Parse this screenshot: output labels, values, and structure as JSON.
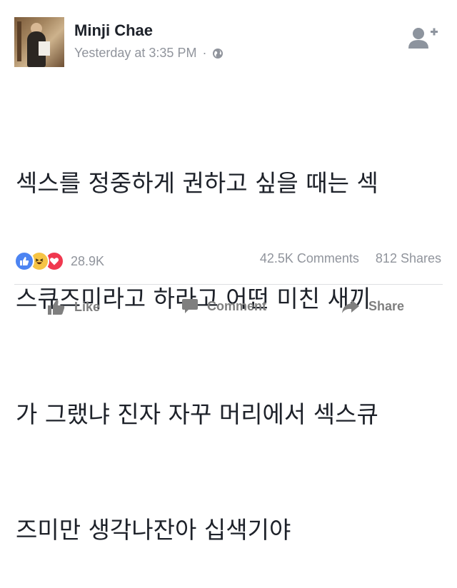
{
  "post": {
    "author": "Minji Chae",
    "timestamp": "Yesterday at 3:35 PM",
    "separator": "·",
    "privacy_icon": "globe-icon",
    "text_lines": [
      "섹스를 정중하게 권하고 싶을 때는 섹",
      "스큐즈미라고 하라고 어떤 미친 새끼",
      "가 그랬냐 진자 자꾸 머리에서 섹스큐",
      "즈미만 생각나잔아 십색기야"
    ]
  },
  "reactions": {
    "icons": [
      "like-reaction-icon",
      "haha-reaction-icon",
      "love-reaction-icon"
    ],
    "count": "28.9K"
  },
  "engagement": {
    "comments": "42.5K Comments",
    "shares": "812 Shares"
  },
  "actions": {
    "like": "Like",
    "comment": "Comment",
    "share": "Share"
  },
  "colors": {
    "like_blue": "#4c84f2",
    "haha_yellow": "#f6c445",
    "love_red": "#f0384f",
    "meta_gray": "#90949c"
  }
}
